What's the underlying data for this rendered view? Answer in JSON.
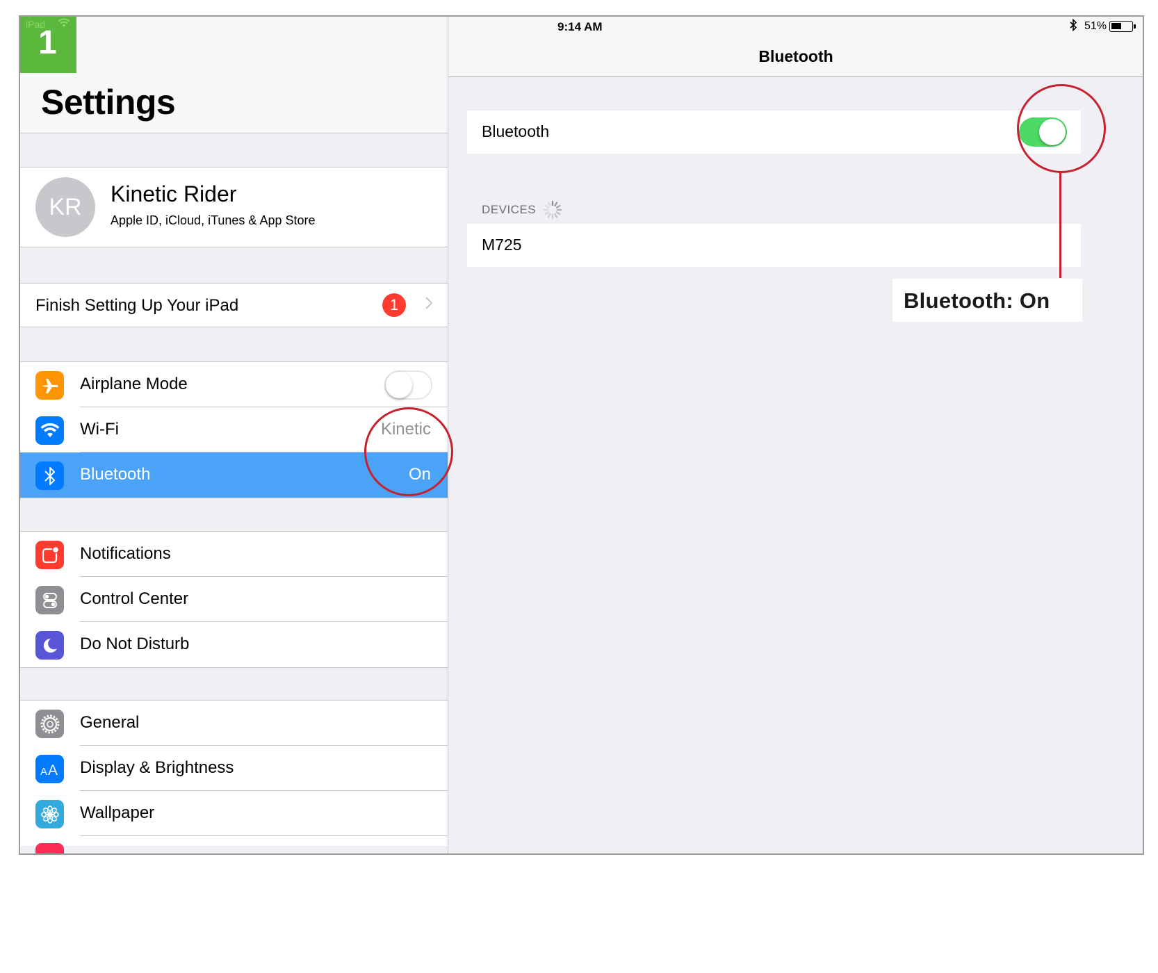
{
  "step": {
    "number": "1",
    "device_label": "iPad"
  },
  "status_bar": {
    "time": "9:14 AM",
    "battery_percent": "51%",
    "battery_level": 0.51
  },
  "master": {
    "title": "Settings",
    "profile": {
      "initials": "KR",
      "name": "Kinetic Rider",
      "subtitle": "Apple ID, iCloud, iTunes & App Store"
    },
    "finish_setup": {
      "label": "Finish Setting Up Your iPad",
      "badge": "1"
    },
    "connectivity": [
      {
        "label": "Airplane Mode",
        "icon": "airplane-icon",
        "color": "#ff9500",
        "toggle": "off"
      },
      {
        "label": "Wi-Fi",
        "icon": "wifi-icon",
        "color": "#007aff",
        "value": "Kinetic"
      },
      {
        "label": "Bluetooth",
        "icon": "bluetooth-icon",
        "color": "#007aff",
        "value": "On",
        "selected": true
      }
    ],
    "notifications": [
      {
        "label": "Notifications",
        "icon": "notifications-icon",
        "color": "#ff3b30"
      },
      {
        "label": "Control Center",
        "icon": "control-center-icon",
        "color": "#8e8e93"
      },
      {
        "label": "Do Not Disturb",
        "icon": "moon-icon",
        "color": "#5856d6"
      }
    ],
    "general": [
      {
        "label": "General",
        "icon": "gear-icon",
        "color": "#8e8e93"
      },
      {
        "label": "Display & Brightness",
        "icon": "display-icon",
        "color": "#007aff"
      },
      {
        "label": "Wallpaper",
        "icon": "wallpaper-icon",
        "color": "#34aadc"
      }
    ]
  },
  "detail": {
    "nav_title": "Bluetooth",
    "bluetooth_toggle": {
      "label": "Bluetooth",
      "state": "on"
    },
    "devices_header": "DEVICES",
    "devices": [
      "M725"
    ]
  },
  "annotation": {
    "callout_text": "Bluetooth: On",
    "color": "#c8202f"
  }
}
